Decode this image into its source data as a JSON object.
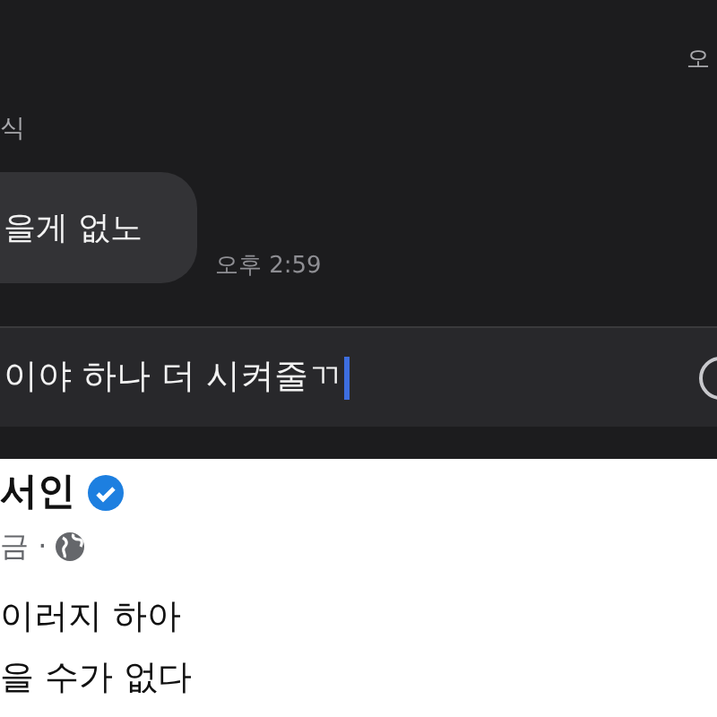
{
  "chat": {
    "top_time": "오",
    "sender": "식",
    "message": "을게 없노",
    "message_time": "오후 2:59"
  },
  "composer": {
    "value": "이야 하나 더 시켜줄ㄲ"
  },
  "post": {
    "author": "서인",
    "verified": true,
    "meta": "금 ·",
    "lines": [
      "이러지 하아",
      "을 수가 없다"
    ]
  }
}
